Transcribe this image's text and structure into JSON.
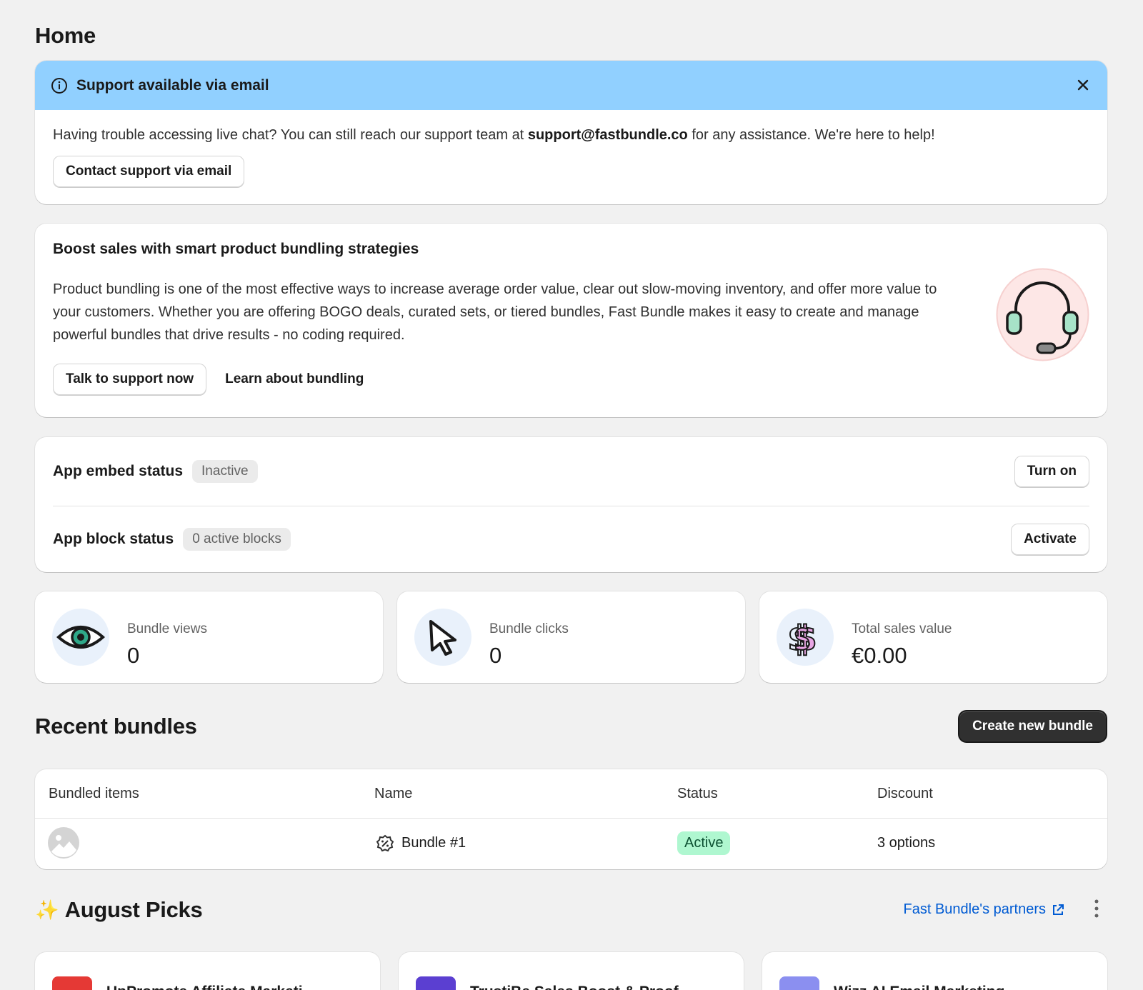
{
  "page": {
    "title": "Home"
  },
  "banner": {
    "title": "Support available via email",
    "text_before": "Having trouble accessing live chat? You can still reach our support team at ",
    "email": "support@fastbundle.co",
    "text_after": " for any assistance. We're here to help!",
    "button_label": "Contact support via email",
    "info_icon": "info-icon",
    "close_icon": "close-icon",
    "color": "#91d0ff"
  },
  "promo": {
    "title": "Boost sales with smart product bundling strategies",
    "body": "Product bundling is one of the most effective ways to increase average order value, clear out slow-moving inventory, and offer more value to your customers. Whether you are offering BOGO deals, curated sets, or tiered bundles, Fast Bundle makes it easy to create and manage powerful bundles that drive results - no coding required.",
    "primary_button": "Talk to support now",
    "secondary_button": "Learn about bundling",
    "illustration": "headset-icon"
  },
  "status": {
    "embed": {
      "label": "App embed status",
      "badge": "Inactive",
      "button": "Turn on"
    },
    "block": {
      "label": "App block status",
      "badge": "0 active blocks",
      "button": "Activate"
    }
  },
  "metrics": [
    {
      "icon": "eye-icon",
      "label": "Bundle views",
      "value": "0"
    },
    {
      "icon": "cursor-icon",
      "label": "Bundle clicks",
      "value": "0"
    },
    {
      "icon": "dollar-icon",
      "label": "Total sales value",
      "value": "€0.00"
    }
  ],
  "recent_bundles": {
    "title": "Recent bundles",
    "create_button": "Create new bundle",
    "columns": [
      "Bundled items",
      "Name",
      "Status",
      "Discount"
    ],
    "rows": [
      {
        "item_icon": "image-placeholder-icon",
        "name_icon": "discount-badge-icon",
        "name": "Bundle #1",
        "status": "Active",
        "discount": "3 options"
      }
    ]
  },
  "picks": {
    "emoji": "✨",
    "title": "August Picks",
    "link_label": "Fast Bundle's partners",
    "link_icon": "external-link-icon",
    "menu_icon": "more-vertical-icon",
    "cards": [
      {
        "name": "UpPromote Affiliate Marketi",
        "logo_color": "#e53935"
      },
      {
        "name": "TrustiBe Sales Boost & Proof",
        "logo_color": "#5b3fd1"
      },
      {
        "name": "Wizz AI Email Marketing",
        "logo_color": "#8b8ff0"
      }
    ]
  }
}
